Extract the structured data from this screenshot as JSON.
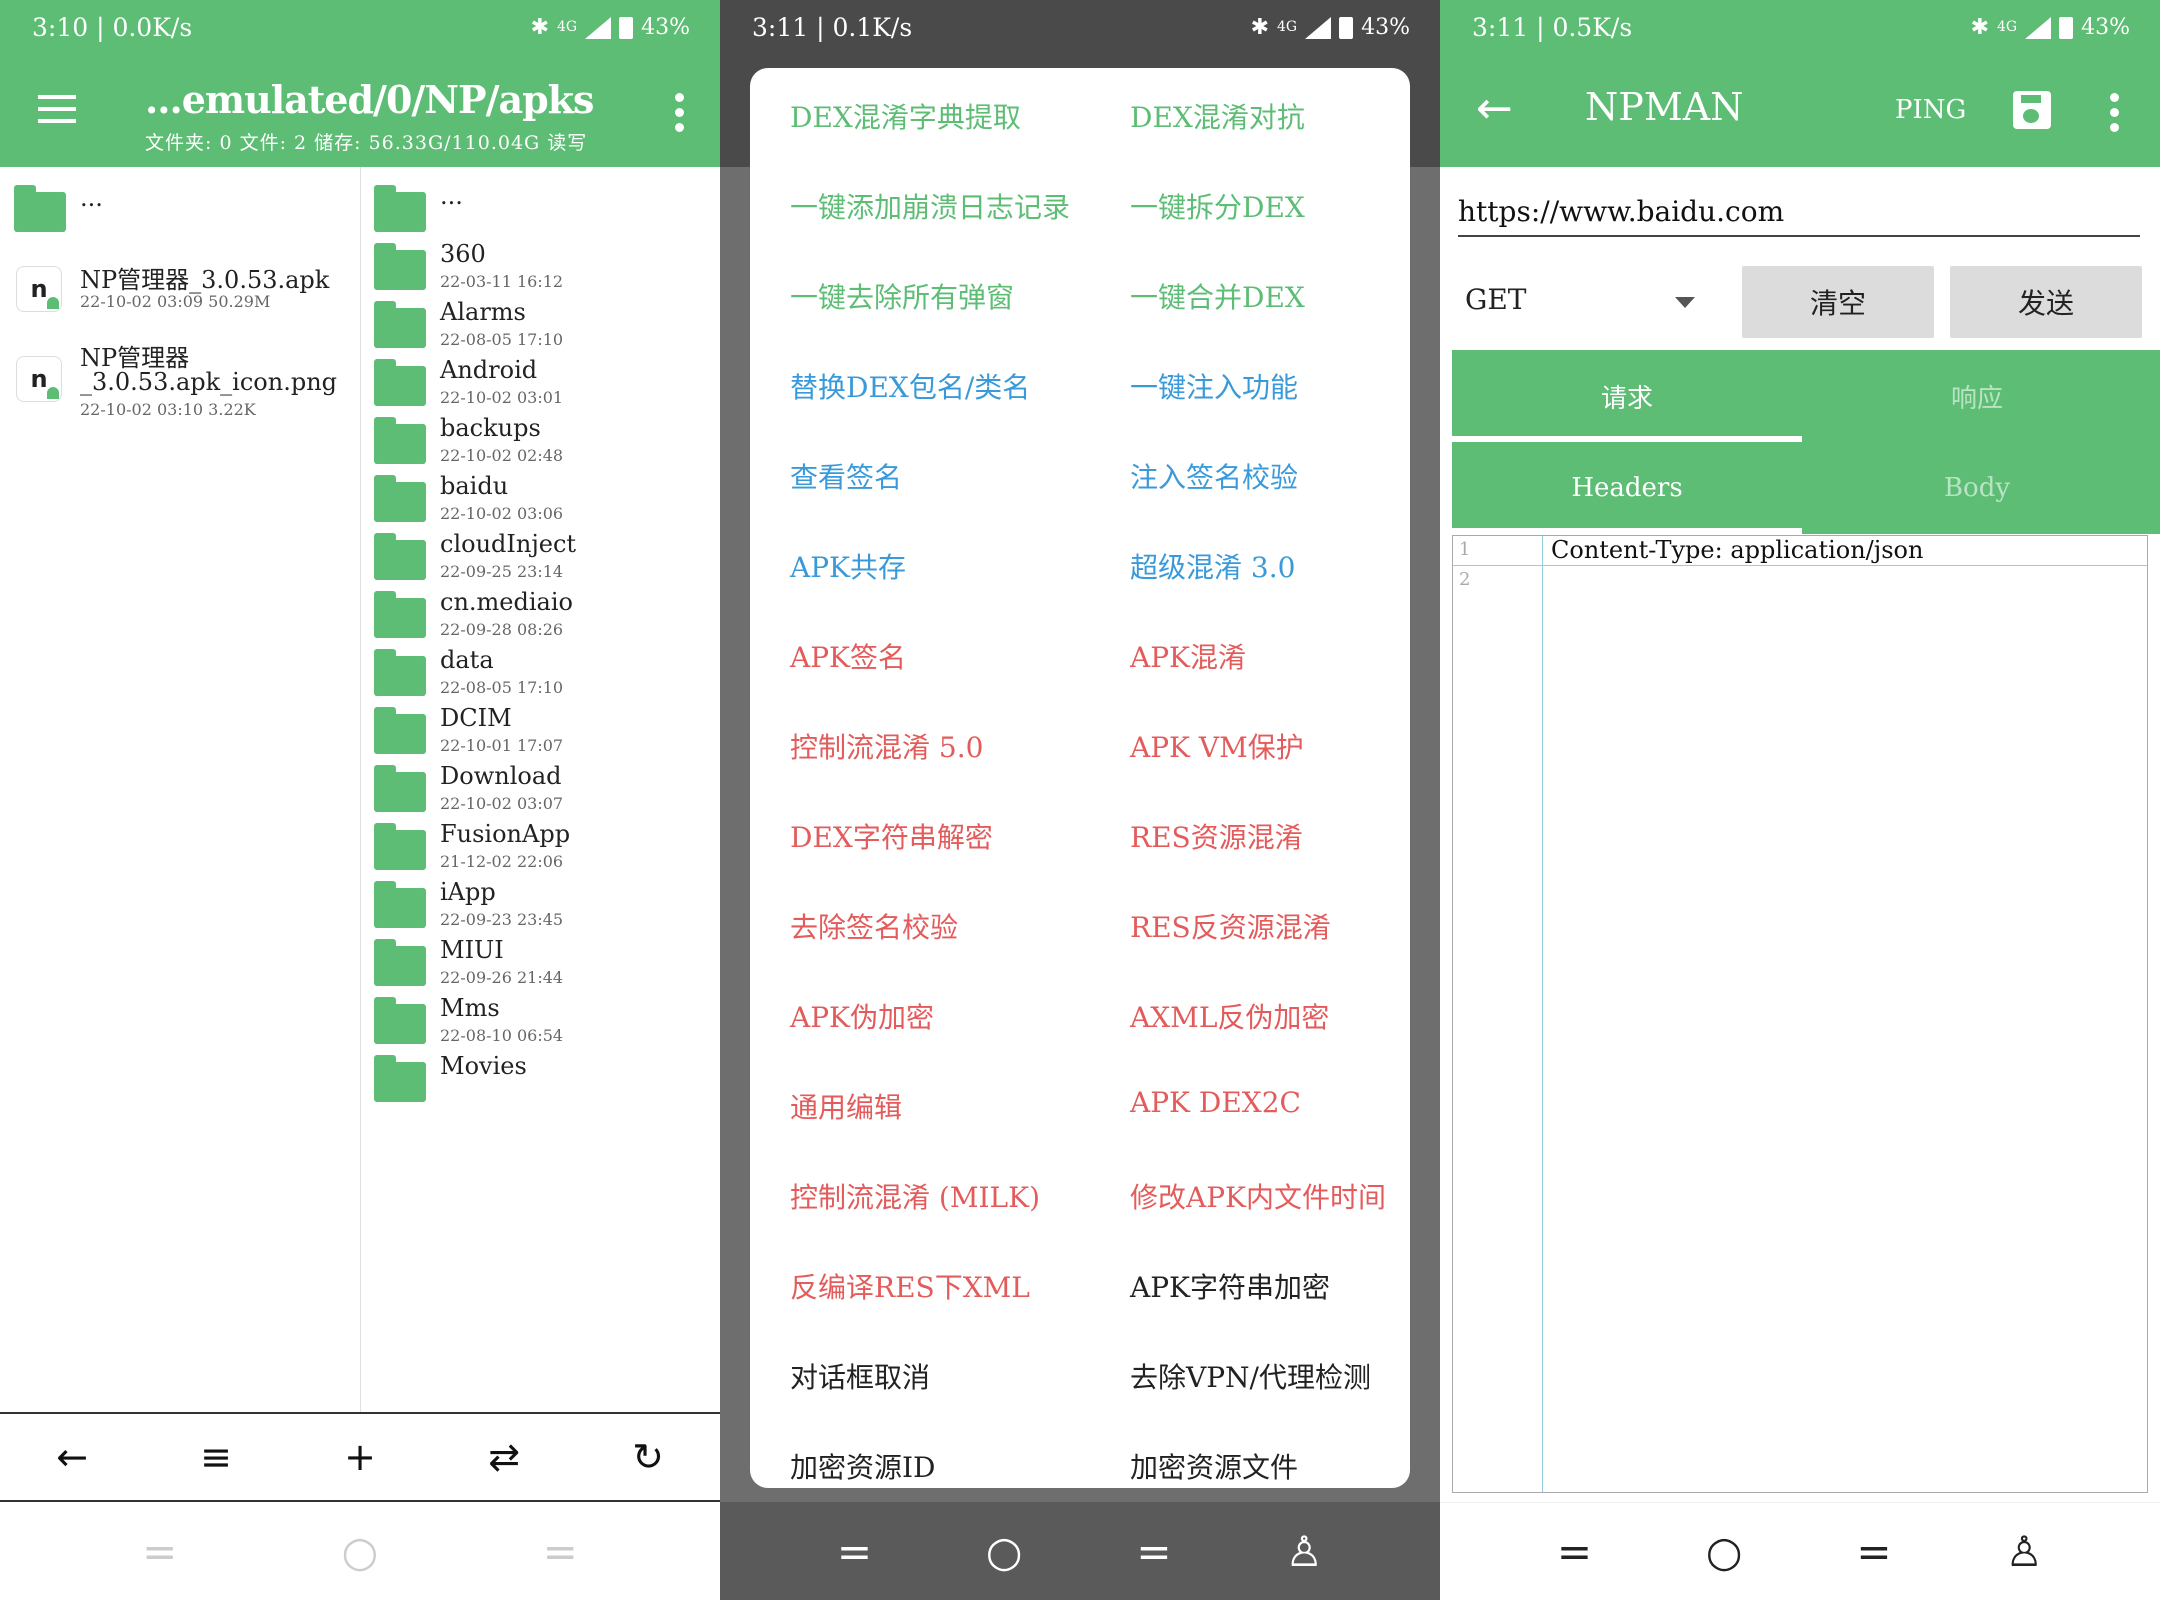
{
  "panel1": {
    "status": {
      "time": "3:10 | 0.0K/s",
      "signal": "4G",
      "battery": "43%"
    },
    "title": "...emulated/0/NP/apks",
    "subtitle": "文件夹: 0  文件: 2  储存: 56.33G/110.04G    读写",
    "left_list": [
      {
        "name": "...",
        "date": ""
      },
      {
        "name": "NP管理器_3.0.53.apk",
        "date": "22-10-02 03:09  50.29M"
      },
      {
        "name": "NP管理器",
        "name2": "_3.0.53.apk_icon.png",
        "date": "22-10-02 03:10  3.22K"
      }
    ],
    "right_list": [
      {
        "name": "...",
        "date": ""
      },
      {
        "name": "360",
        "date": "22-03-11 16:12"
      },
      {
        "name": "Alarms",
        "date": "22-08-05 17:10"
      },
      {
        "name": "Android",
        "date": "22-10-02 03:01"
      },
      {
        "name": "backups",
        "date": "22-10-02 02:48"
      },
      {
        "name": "baidu",
        "date": "22-10-02 03:06"
      },
      {
        "name": "cloudInject",
        "date": "22-09-25 23:14"
      },
      {
        "name": "cn.mediaio",
        "date": "22-09-28 08:26"
      },
      {
        "name": "data",
        "date": "22-08-05 17:10"
      },
      {
        "name": "DCIM",
        "date": "22-10-01 17:07"
      },
      {
        "name": "Download",
        "date": "22-10-02 03:07"
      },
      {
        "name": "FusionApp",
        "date": "21-12-02 22:06"
      },
      {
        "name": "iApp",
        "date": "22-09-23 23:45"
      },
      {
        "name": "MIUI",
        "date": "22-09-26 21:44"
      },
      {
        "name": "Mms",
        "date": "22-08-10 06:54"
      },
      {
        "name": "Movies",
        "date": ""
      }
    ],
    "toolbar": {
      "back": "←",
      "list": "≡",
      "add": "+",
      "swap": "⇄",
      "refresh": "↻"
    }
  },
  "panel2": {
    "status": {
      "time": "3:11 | 0.1K/s",
      "signal": "4G",
      "battery": "43%"
    },
    "menu": [
      {
        "l": "DEX混淆字典提取",
        "r": "DEX混淆对抗",
        "lc": "g",
        "rc": "g"
      },
      {
        "l": "一键添加崩溃日志记录",
        "r": "一键拆分DEX",
        "lc": "g",
        "rc": "g"
      },
      {
        "l": "一键去除所有弹窗",
        "r": "一键合并DEX",
        "lc": "g",
        "rc": "g"
      },
      {
        "l": "替换DEX包名/类名",
        "r": "一键注入功能",
        "lc": "b",
        "rc": "b"
      },
      {
        "l": "查看签名",
        "r": "注入签名校验",
        "lc": "b",
        "rc": "b"
      },
      {
        "l": "APK共存",
        "r": "超级混淆 3.0",
        "lc": "b",
        "rc": "b"
      },
      {
        "l": "APK签名",
        "r": "APK混淆",
        "lc": "r",
        "rc": "r"
      },
      {
        "l": "控制流混淆 5.0",
        "r": "APK VM保护",
        "lc": "r",
        "rc": "r"
      },
      {
        "l": "DEX字符串解密",
        "r": "RES资源混淆",
        "lc": "r",
        "rc": "r"
      },
      {
        "l": "去除签名校验",
        "r": "RES反资源混淆",
        "lc": "r",
        "rc": "r"
      },
      {
        "l": "APK伪加密",
        "r": "AXML反伪加密",
        "lc": "r",
        "rc": "r"
      },
      {
        "l": "通用编辑",
        "r": "APK DEX2C",
        "lc": "r",
        "rc": "r"
      },
      {
        "l": "控制流混淆 (MILK)",
        "r": "修改APK内文件时间",
        "lc": "r",
        "rc": "r"
      },
      {
        "l": "反编译RES下XML",
        "r": "APK字符串加密",
        "lc": "r",
        "rc": "k"
      },
      {
        "l": "对话框取消",
        "r": "去除VPN/代理检测",
        "lc": "k",
        "rc": "k"
      },
      {
        "l": "加密资源ID",
        "r": "加密资源文件",
        "lc": "k",
        "rc": "k"
      }
    ]
  },
  "panel3": {
    "status": {
      "time": "3:11 | 0.5K/s",
      "signal": "4G",
      "battery": "43%"
    },
    "title": "NPMAN",
    "ping": "PING",
    "url": "https://www.baidu.com",
    "method": "GET",
    "clear": "清空",
    "send": "发送",
    "tab_request": "请求",
    "tab_response": "响应",
    "tab_headers": "Headers",
    "tab_body": "Body",
    "line1": "1",
    "line2": "2",
    "code1": "Content-Type: application/json"
  },
  "colors": {
    "green": "#5dbd75",
    "blue": "#3a9ad9",
    "red": "#e35b5b"
  }
}
